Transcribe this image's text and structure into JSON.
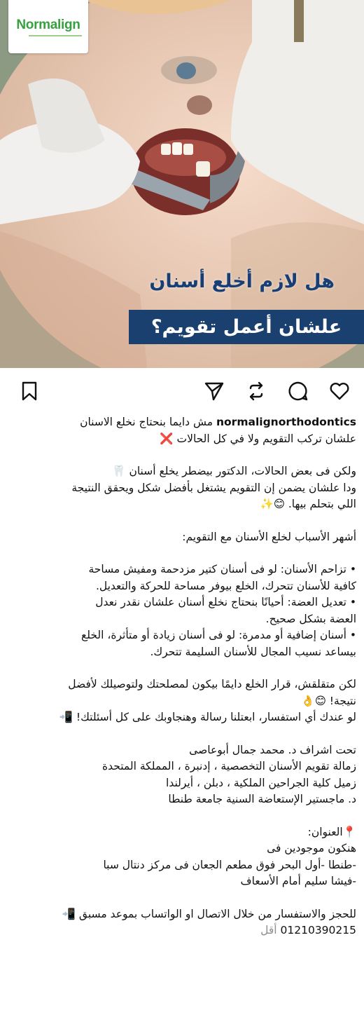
{
  "post": {
    "brand": "Normalign",
    "headline_line1": "هل لازم أخلع أسنان",
    "headline_line2": "علشان أعمل تقويم؟",
    "colors": {
      "headline": "#173f75",
      "band": "#19406f",
      "logo_green": "#36a13f"
    }
  },
  "actions": {
    "like": "heart-icon",
    "comment": "comment-icon",
    "repost": "repost-icon",
    "share": "send-icon",
    "save": "bookmark-icon"
  },
  "caption": {
    "username": "normalignorthodontics",
    "intro_rest": " مش دايما بنحتاج نخلع الاسنان",
    "intro_line2": "علشان تركب التقويم ولا في كل الحالات ❌",
    "para2_line1": "ولكن فى بعض الحالات، الدكتور بيضطر يخلع أسنان 🦷",
    "para2_line2": "ودا علشان يضمن إن التقويم يشتغل بأفضل شكل ويحقق النتيجة",
    "para2_line3": "اللي بتحلم بيها. 😊✨",
    "reasons_title": "أشهر الأسباب لخلع الأسنان مع التقويم:",
    "reason1_line1": "• تزاحم الأسنان: لو فى أسنان كتير مزدحمة ومفيش مساحة",
    "reason1_line2": "كافية للأسنان تتحرك، الخلع بيوفر مساحة للحركة والتعديل.",
    "reason2_line1": "• تعديل العضة: أحيانًا بنحتاج نخلع أسنان علشان نقدر نعدل",
    "reason2_line2": "العضة بشكل صحيح.",
    "reason3_line1": "• أسنان إضافية أو مدمرة: لو فى أسنان زيادة أو متأثرة، الخلع",
    "reason3_line2": "بيساعد نسيب المجال للأسنان السليمة تتحرك.",
    "closing_line1": "لكن متقلقش، قرار الخلع دايمًا بيكون لمصلحتك ولتوصيلك لأفضل",
    "closing_line2": "نتيجة! 😊👌",
    "closing_line3": "لو عندك أي استفسار، ابعتلنا رسالة وهنجاوبك على كل أسئلتك! 📲",
    "doctor_line1": "تحت اشراف د. محمد جمال أبوعاصى",
    "doctor_line2": "زمالة تقويم الأسنان التخصصية ، إدنبرة ، المملكة المتحدة",
    "doctor_line3": "زميل كلية الجراحين الملكية ، دبلن ، أيرلندا",
    "doctor_line4": "د. ماجستير الإستعاضة السنية جامعة طنطا",
    "address_title": "📍العنوان:",
    "address_line1": "هنكون موجودين فى",
    "address_line2": "-طنطا -أول البحر فوق مطعم الجعان فى مركز دنتال سبا",
    "address_line3": "-فيشا سليم أمام الأسعاف",
    "booking_line1": "للحجز والاستفسار من خلال الاتصال او الواتساب بموعد مسبق 📲",
    "phone": "01210390215",
    "less": "أقل"
  }
}
